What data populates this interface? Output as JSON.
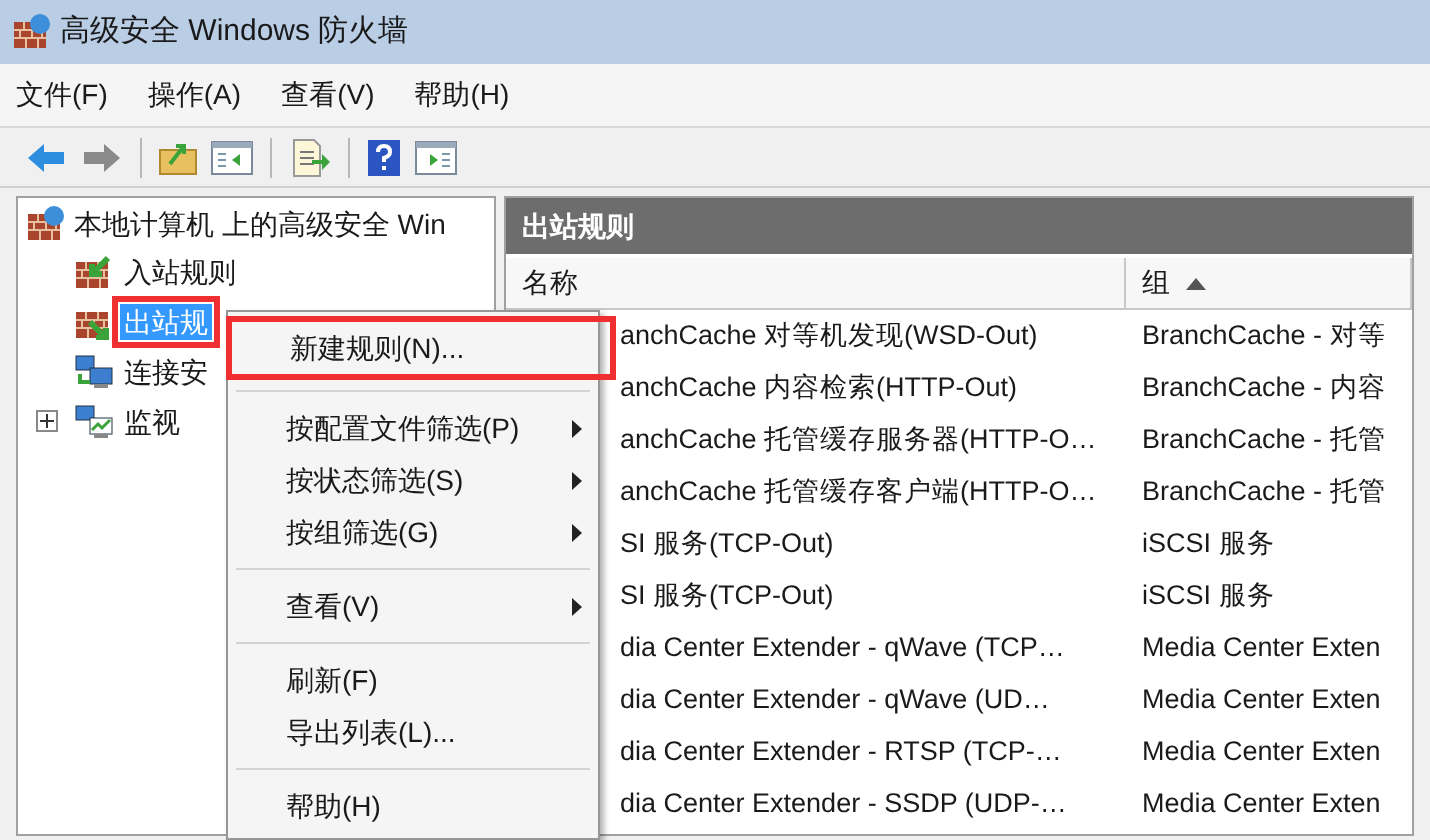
{
  "window": {
    "title": "高级安全 Windows 防火墙"
  },
  "menu_bar": [
    "文件(F)",
    "操作(A)",
    "查看(V)",
    "帮助(H)"
  ],
  "toolbar": [
    {
      "kind": "back",
      "disabled": false
    },
    {
      "kind": "forward",
      "disabled": true
    },
    {
      "kind": "sep"
    },
    {
      "kind": "up"
    },
    {
      "kind": "tree"
    },
    {
      "kind": "sep"
    },
    {
      "kind": "export"
    },
    {
      "kind": "sep"
    },
    {
      "kind": "help"
    },
    {
      "kind": "pane"
    }
  ],
  "tree": {
    "label": "本地计算机 上的高级安全 Win",
    "children": [
      {
        "label": "入站规则",
        "kind": "inbound",
        "selected": false,
        "annotated": false
      },
      {
        "label": "出站规",
        "kind": "outbound",
        "selected": true,
        "annotated": true
      },
      {
        "label": "连接安",
        "kind": "connection",
        "selected": false,
        "annotated": false
      },
      {
        "label": "监视",
        "kind": "monitor",
        "selected": false,
        "annotated": false,
        "expanded": false
      }
    ]
  },
  "pane": {
    "title": "出站规则",
    "table": {
      "columns": [
        {
          "label": "名称",
          "sorted": false
        },
        {
          "label": "组",
          "sorted": true
        }
      ],
      "rows": [
        [
          "anchCache 对等机发现(WSD-Out)",
          "BranchCache - 对等"
        ],
        [
          "anchCache 内容检索(HTTP-Out)",
          "BranchCache - 内容"
        ],
        [
          "anchCache 托管缓存服务器(HTTP-O…",
          "BranchCache - 托管"
        ],
        [
          "anchCache 托管缓存客户端(HTTP-O…",
          "BranchCache - 托管"
        ],
        [
          "SI 服务(TCP-Out)",
          "iSCSI 服务"
        ],
        [
          "SI 服务(TCP-Out)",
          "iSCSI 服务"
        ],
        [
          "dia Center Extender - qWave (TCP…",
          "Media Center Exten"
        ],
        [
          "dia Center Extender - qWave (UD…",
          "Media Center Exten"
        ],
        [
          "dia Center Extender - RTSP (TCP-…",
          "Media Center Exten"
        ],
        [
          "dia Center Extender - SSDP (UDP-…",
          "Media Center Exten"
        ]
      ]
    }
  },
  "context_menu": [
    {
      "kind": "item",
      "label": "新建规则(N)...",
      "submenu": false,
      "annotated": true
    },
    {
      "kind": "separator"
    },
    {
      "kind": "item",
      "label": "按配置文件筛选(P)",
      "submenu": true
    },
    {
      "kind": "item",
      "label": "按状态筛选(S)",
      "submenu": true
    },
    {
      "kind": "item",
      "label": "按组筛选(G)",
      "submenu": true
    },
    {
      "kind": "separator"
    },
    {
      "kind": "item",
      "label": "查看(V)",
      "submenu": true
    },
    {
      "kind": "separator"
    },
    {
      "kind": "item",
      "label": "刷新(F)",
      "submenu": false
    },
    {
      "kind": "item",
      "label": "导出列表(L)...",
      "submenu": false
    },
    {
      "kind": "separator"
    },
    {
      "kind": "item",
      "label": "帮助(H)",
      "submenu": false
    }
  ]
}
